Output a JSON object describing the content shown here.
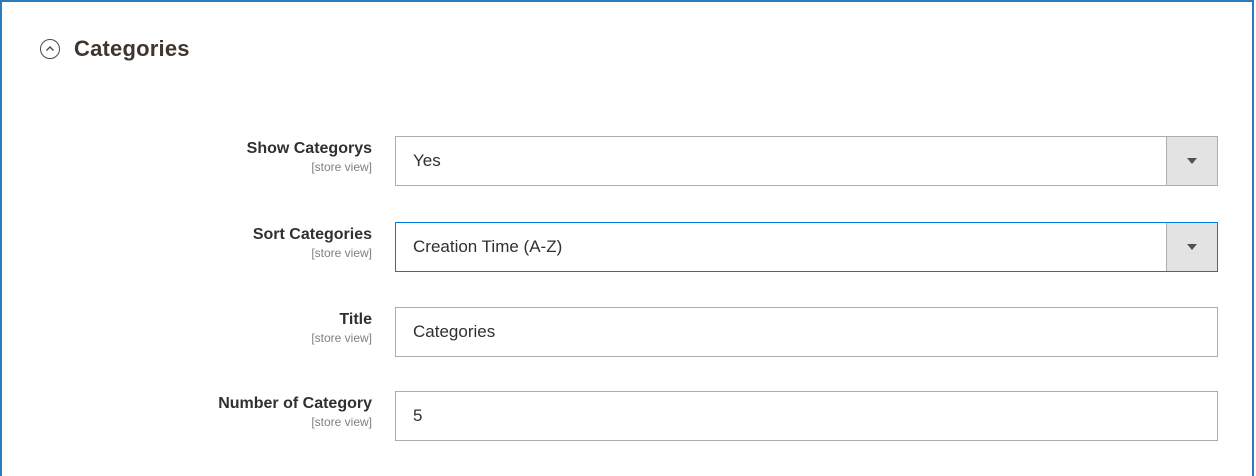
{
  "section": {
    "title": "Categories",
    "toggle_icon": "chevron-up-circle-icon"
  },
  "fields": [
    {
      "label": "Show Categorys",
      "scope": "[store view]",
      "type": "select",
      "value": "Yes",
      "icon": "dropdown-arrow-icon"
    },
    {
      "label": "Sort Categories",
      "scope": "[store view]",
      "type": "select",
      "value": "Creation Time (A-Z)",
      "icon": "dropdown-arrow-icon",
      "focused": true
    },
    {
      "label": "Title",
      "scope": "[store view]",
      "type": "text",
      "value": "Categories"
    },
    {
      "label": "Number of Category",
      "scope": "[store view]",
      "type": "text",
      "value": "5"
    }
  ],
  "colors": {
    "frame_border": "#2b7bbd",
    "focus_border": "#007bdb",
    "arrow_bg": "#e3e3e3"
  }
}
